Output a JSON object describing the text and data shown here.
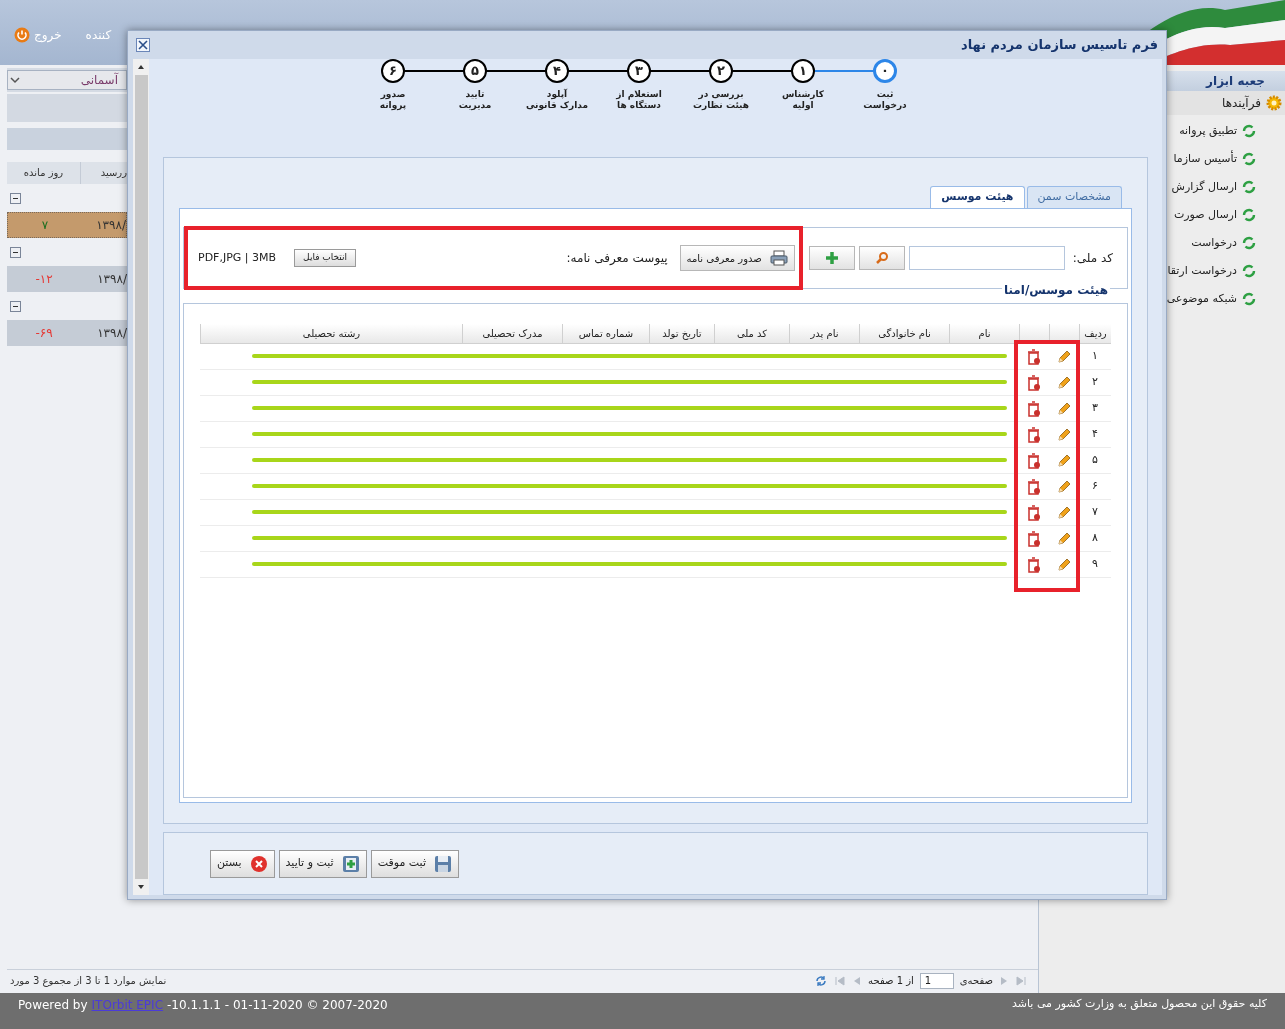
{
  "header": {
    "user_label": "کننده",
    "logout": "خروج"
  },
  "background_list": {
    "filter": "آسمانی",
    "columns": [
      "ررسید",
      "روز مانده"
    ],
    "groups": [
      {
        "days": "۷",
        "color": "#1b6e20",
        "date": "۱۳۹۸/",
        "selected": true
      },
      {
        "days": "-۱۲",
        "color": "#e53935",
        "date": "۱۳۹۸/",
        "selected": false
      },
      {
        "days": "-۶۹",
        "color": "#e53935",
        "date": "۱۳۹۸/",
        "selected": false
      }
    ]
  },
  "status": {
    "summary": "نمایش موارد 1 تا 3 از مجموع 3 مورد",
    "page_label": "صفحه‌ی",
    "page": "1",
    "page_total": "از 1 صفحه"
  },
  "toolbox": {
    "title": "جعبه ابزار",
    "section": "فرآیندها",
    "items": [
      "تطبیق پروانه",
      "تأسیس سازما",
      "ارسال گزارش",
      "ارسال صورت",
      "درخواست",
      "درخواست ارتقا",
      "شبکه موضوعی"
    ]
  },
  "dialog": {
    "title": "فرم تاسیس سازمان مردم نهاد",
    "steps": [
      {
        "number": "۰",
        "label": [
          "ثبت",
          "درخواست"
        ],
        "selected": true
      },
      {
        "number": "۱",
        "label": [
          "کارشناس",
          "اولیه"
        ],
        "selected": false
      },
      {
        "number": "۲",
        "label": [
          "بررسی در",
          "هیئت نظارت"
        ],
        "selected": false
      },
      {
        "number": "۳",
        "label": [
          "استعلام از",
          "دستگاه ها"
        ],
        "selected": false
      },
      {
        "number": "۴",
        "label": [
          "آپلود",
          "مدارک قانونی"
        ],
        "selected": false
      },
      {
        "number": "۵",
        "label": [
          "تایید",
          "مدیریت"
        ],
        "selected": false
      },
      {
        "number": "۶",
        "label": [
          "صدور",
          "پروانه"
        ],
        "selected": false
      }
    ],
    "tabs": [
      {
        "label": "مشخصات سمن",
        "selected": false
      },
      {
        "label": "هیئت موسس",
        "selected": true
      }
    ],
    "member_search": {
      "label": "کد ملی:",
      "letter_button": "صدور معرفی نامه",
      "attachment_label": "پیوست معرفی نامه:",
      "file_button": "انتخاب فایل",
      "file_hint": "PDF,JPG | 3MB",
      "highlighted": true
    },
    "group_title": "هیئت موسس/امنا",
    "table": {
      "columns": [
        "ردیف",
        "نام",
        "نام خانوادگی",
        "نام پدر",
        "کد ملی",
        "تاریخ تولد",
        "شماره تماس",
        "مدرک تحصیلی",
        "رشته تحصیلی"
      ],
      "actions_highlighted": true,
      "rows": [
        {
          "row": "۱",
          "redacted": true
        },
        {
          "row": "۲",
          "redacted": true
        },
        {
          "row": "۳",
          "redacted": true
        },
        {
          "row": "۴",
          "redacted": true
        },
        {
          "row": "۵",
          "redacted": true
        },
        {
          "row": "۶",
          "redacted": true
        },
        {
          "row": "۷",
          "redacted": true
        },
        {
          "row": "۸",
          "redacted": true
        },
        {
          "row": "۹",
          "redacted": true
        }
      ]
    },
    "buttons": [
      {
        "label": "ثبت موقت",
        "kind": "save"
      },
      {
        "label": "ثبت و تایید",
        "kind": "confirm"
      },
      {
        "label": "بستن",
        "kind": "close"
      }
    ]
  },
  "footer": {
    "powered_by": "Powered by",
    "product_link": "ITOrbit EPIC",
    "version": "-10.1.1.1 - 01-11-2020 © 2007-2020",
    "copyright": "کلیه حقوق این محصول متعلق به وزارت کشور می باشد"
  }
}
